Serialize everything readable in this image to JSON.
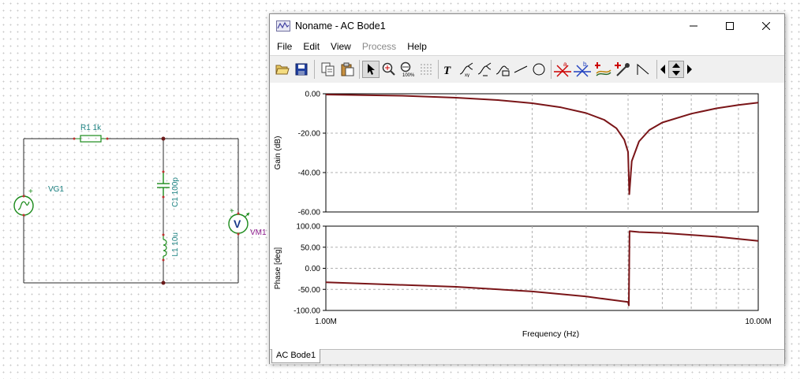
{
  "schematic": {
    "r1_label": "R1 1k",
    "vg1_label": "VG1",
    "c1_label": "C1 100p",
    "l1_label": "L1 10u",
    "vm1_label": "VM1",
    "vm_symbol": "V",
    "plus_sign": "+"
  },
  "window": {
    "title": "Noname - AC Bode1",
    "tab_label": "AC Bode1"
  },
  "menu": [
    "File",
    "Edit",
    "View",
    "Process",
    "Help"
  ],
  "menu_disabled": [
    false,
    false,
    false,
    true,
    false
  ],
  "toolbar_icons": [
    "open-icon",
    "save-icon",
    "copy-icon",
    "paste-icon",
    "pointer-icon",
    "zoom-in-icon",
    "zoom-100-icon",
    "grid-icon",
    "text-icon",
    "marker-icon",
    "marker2-icon",
    "label-icon",
    "line-icon",
    "circle-icon",
    "cursor-a-icon",
    "cursor-b-icon",
    "add-curve-icon",
    "probe-icon",
    "slope-icon",
    "left-arrow-icon",
    "up-down-icon",
    "right-arrow-icon"
  ],
  "chart_data": [
    {
      "type": "line",
      "ylabel": "Gain (dB)",
      "xlabel": "Frequency (Hz)",
      "xscale": "log",
      "xlim": [
        1000000,
        10000000
      ],
      "ylim": [
        -60,
        0
      ],
      "yticks": [
        "0.00",
        "-20.00",
        "-40.00",
        "-60.00"
      ],
      "xticks": [
        "1.00M",
        "10.00M"
      ],
      "grid": true,
      "line_color": "#7a1518",
      "series": [
        {
          "x": [
            1000000,
            1500000,
            2000000,
            2500000,
            3000000,
            3500000,
            4000000,
            4400000,
            4700000,
            4900000,
            5000000,
            5033000,
            5100000,
            5300000,
            5600000,
            6000000,
            7000000,
            8000000,
            9000000,
            10000000
          ],
          "y": [
            -0.4,
            -1.0,
            -2.0,
            -3.2,
            -4.8,
            -6.9,
            -9.8,
            -13.2,
            -17.5,
            -23.3,
            -29.5,
            -51.0,
            -34.2,
            -24.2,
            -18.4,
            -14.6,
            -10.1,
            -7.4,
            -5.7,
            -4.5
          ]
        }
      ]
    },
    {
      "type": "line",
      "ylabel": "Phase [deg]",
      "xlabel": "Frequency (Hz)",
      "xscale": "log",
      "xlim": [
        1000000,
        10000000
      ],
      "ylim": [
        -100,
        100
      ],
      "yticks": [
        "100.00",
        "50.00",
        "0.00",
        "-50.00",
        "-100.00"
      ],
      "xticks": [
        "1.00M",
        "10.00M"
      ],
      "grid": true,
      "line_color": "#7a1518",
      "series": [
        {
          "x": [
            1000000,
            2000000,
            3000000,
            4000000,
            5000000,
            5020000,
            5040000,
            5300000,
            6000000,
            8000000,
            10000000
          ],
          "y": [
            -33,
            -44,
            -55,
            -67,
            -80,
            -88,
            88,
            86,
            84,
            75,
            65
          ]
        }
      ]
    }
  ]
}
